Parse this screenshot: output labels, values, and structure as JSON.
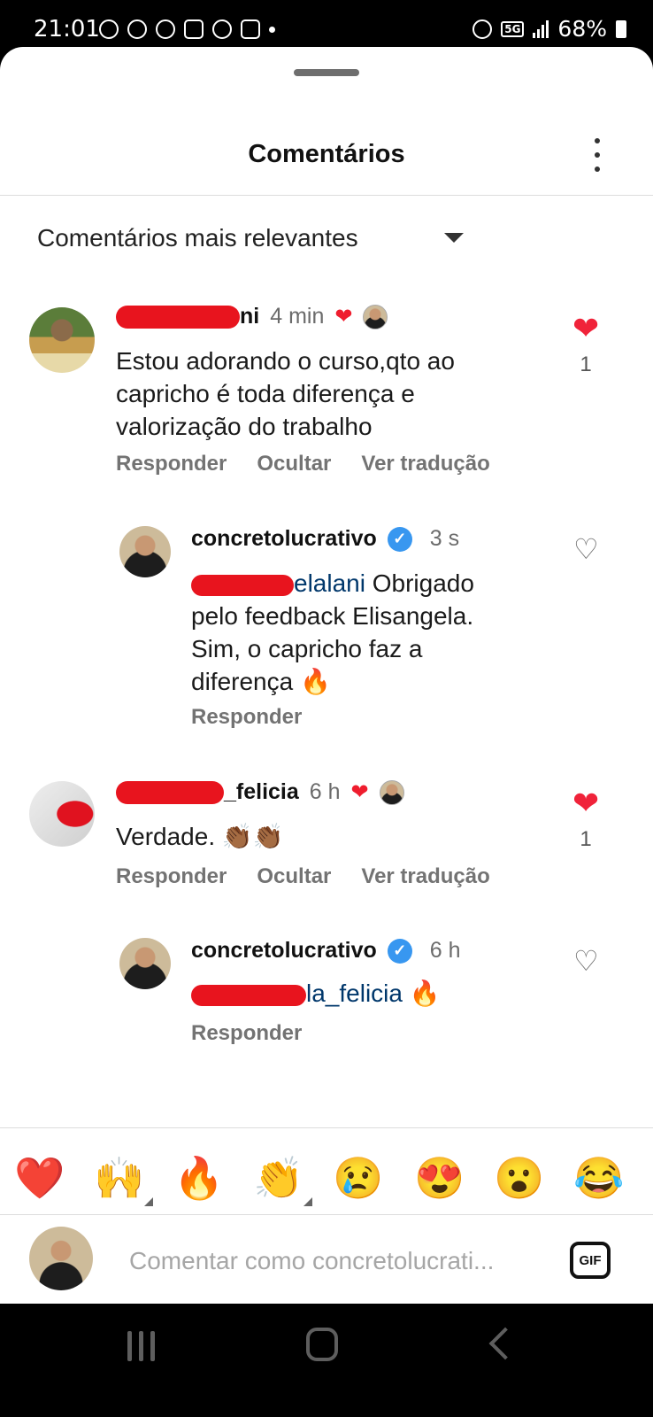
{
  "status_bar": {
    "time": "21:01",
    "network": "5G",
    "battery": "68%"
  },
  "sheet": {
    "title": "Comentários",
    "sort_label": "Comentários mais relevantes"
  },
  "comments": [
    {
      "user_visible": "ni",
      "time": "4 min",
      "text": "Estou adorando o curso,qto ao capricho é toda diferença e valorização do trabalho",
      "actions": [
        "Responder",
        "Ocultar",
        "Ver tradução"
      ],
      "likes": "1",
      "liked_by_author": true,
      "reply": {
        "user": "concretolucrativo",
        "verified": true,
        "time": "3 s",
        "mention_suffix": "elalani",
        "text": "Obrigado pelo feedback Elisangela. Sim, o capricho faz a diferença 🔥",
        "action": "Responder"
      }
    },
    {
      "user_visible": "_felicia",
      "time": "6 h",
      "text": "Verdade. 👏🏾👏🏾",
      "actions": [
        "Responder",
        "Ocultar",
        "Ver tradução"
      ],
      "likes": "1",
      "liked_by_author": true,
      "reply": {
        "user": "concretolucrativo",
        "verified": true,
        "time": "6 h",
        "mention_suffix": "la_felicia",
        "text": "🔥",
        "action": "Responder"
      }
    }
  ],
  "emoji_bar": [
    "❤️",
    "🙌",
    "🔥",
    "👏",
    "😢",
    "😍",
    "😮",
    "😂"
  ],
  "input": {
    "placeholder": "Comentar como concretolucrati...",
    "gif_label": "GIF"
  },
  "colors": {
    "like_red": "#f0233a",
    "mention_blue": "#00376b",
    "verified_blue": "#3897f0"
  }
}
